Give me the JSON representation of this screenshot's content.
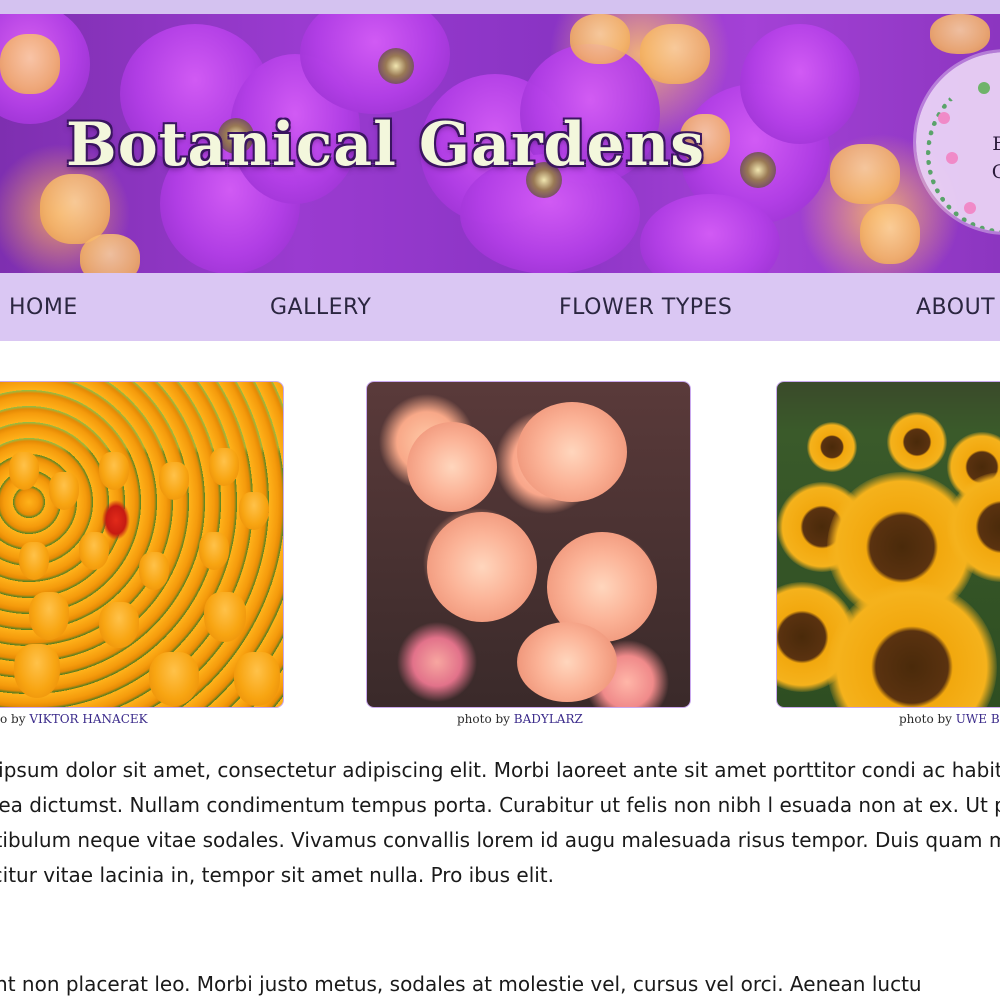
{
  "colors": {
    "top_strip": "#d4c2f0",
    "navbar_background": "#dac7f3",
    "title_fill": "#f3f7dc",
    "title_outline": "#3a1560",
    "photo_border": "#c9a8ee",
    "caption_link": "#3a2a8a"
  },
  "banner": {
    "title": "Botanical Gardens",
    "logo_text_line1": "Bo",
    "logo_text_line2": "Ga",
    "background_icon": "purple-and-orange-flowers-photo"
  },
  "nav": {
    "items": [
      {
        "label": "HOME"
      },
      {
        "label": "GALLERY"
      },
      {
        "label": "FLOWER TYPES"
      },
      {
        "label": "ABOUT"
      }
    ]
  },
  "gallery": {
    "photos": [
      {
        "subject": "tulips-photo",
        "caption_prefix": "o by",
        "credit": "VIKTOR HANACEK"
      },
      {
        "subject": "carnations-photo",
        "caption_prefix": "photo by",
        "credit": "BADYLARZ"
      },
      {
        "subject": "sunflowers-photo",
        "caption_prefix": "photo by",
        "credit": "UWE B"
      }
    ]
  },
  "content": {
    "paragraph_1": "em ipsum dolor sit amet, consectetur adipiscing elit. Morbi laoreet ante sit amet porttitor condi ac habitasse platea dictumst. Nullam condimentum tempus porta. Curabitur ut felis non nibh l esuada non at ex. Ut porttitor vestibulum neque vitae sodales. Vivamus convallis lorem id augu malesuada risus tempor. Duis quam magna, efficitur vitae lacinia in, tempor sit amet nulla. Pro ibus elit.",
    "paragraph_2": "esent non placerat leo. Morbi justo metus, sodales at molestie vel, cursus vel orci. Aenean luctu"
  }
}
